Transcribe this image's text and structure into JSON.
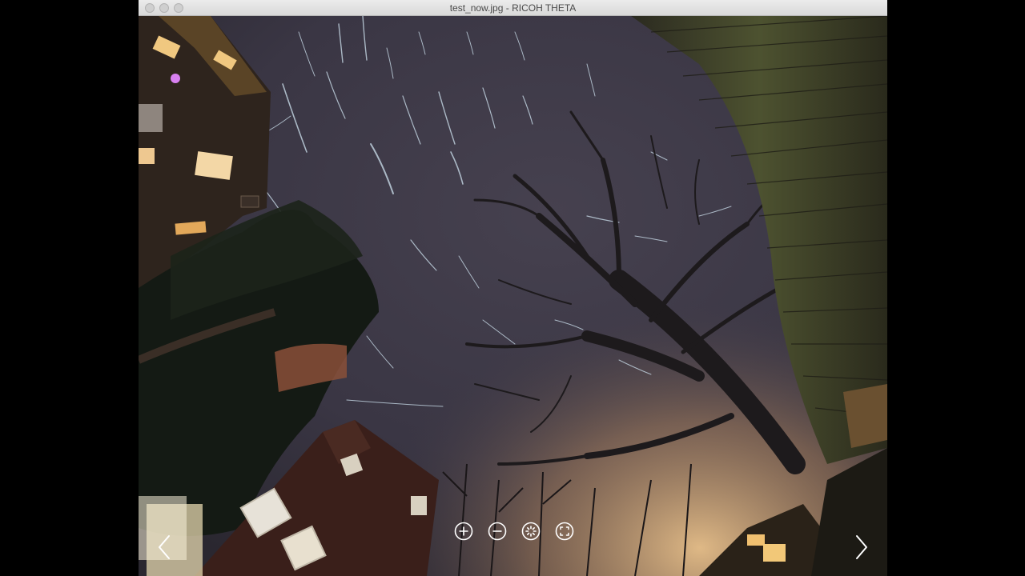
{
  "window": {
    "title": "test_now.jpg - RICOH THETA"
  },
  "viewer": {
    "image_description_icon": "panorama-photo",
    "controls": [
      {
        "name": "zoom-in-button",
        "icon": "plus-circle-icon"
      },
      {
        "name": "zoom-out-button",
        "icon": "minus-circle-icon"
      },
      {
        "name": "autoplay-button",
        "icon": "spinner-circle-icon"
      },
      {
        "name": "fullscreen-button",
        "icon": "fullscreen-circle-icon"
      }
    ],
    "prev_icon": "chevron-left-icon",
    "next_icon": "chevron-right-icon"
  },
  "colors": {
    "titlebar": "#e4e4e4",
    "sky": "#3e3a48",
    "control_stroke": "#ffffff"
  }
}
